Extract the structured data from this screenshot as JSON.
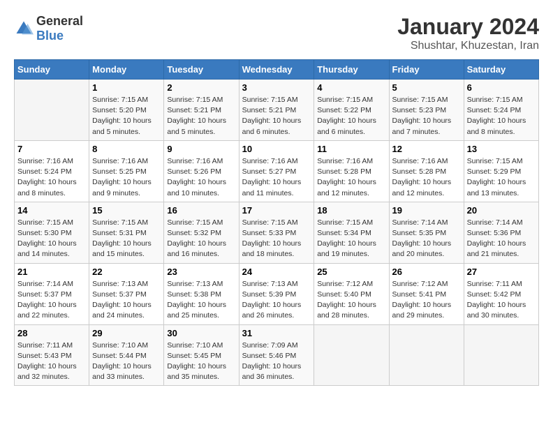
{
  "header": {
    "logo": {
      "general": "General",
      "blue": "Blue"
    },
    "title": "January 2024",
    "subtitle": "Shushtar, Khuzestan, Iran"
  },
  "days_of_week": [
    "Sunday",
    "Monday",
    "Tuesday",
    "Wednesday",
    "Thursday",
    "Friday",
    "Saturday"
  ],
  "weeks": [
    [
      {
        "day": null,
        "sunrise": null,
        "sunset": null,
        "daylight": null
      },
      {
        "day": "1",
        "sunrise": "Sunrise: 7:15 AM",
        "sunset": "Sunset: 5:20 PM",
        "daylight": "Daylight: 10 hours and 5 minutes."
      },
      {
        "day": "2",
        "sunrise": "Sunrise: 7:15 AM",
        "sunset": "Sunset: 5:21 PM",
        "daylight": "Daylight: 10 hours and 5 minutes."
      },
      {
        "day": "3",
        "sunrise": "Sunrise: 7:15 AM",
        "sunset": "Sunset: 5:21 PM",
        "daylight": "Daylight: 10 hours and 6 minutes."
      },
      {
        "day": "4",
        "sunrise": "Sunrise: 7:15 AM",
        "sunset": "Sunset: 5:22 PM",
        "daylight": "Daylight: 10 hours and 6 minutes."
      },
      {
        "day": "5",
        "sunrise": "Sunrise: 7:15 AM",
        "sunset": "Sunset: 5:23 PM",
        "daylight": "Daylight: 10 hours and 7 minutes."
      },
      {
        "day": "6",
        "sunrise": "Sunrise: 7:15 AM",
        "sunset": "Sunset: 5:24 PM",
        "daylight": "Daylight: 10 hours and 8 minutes."
      }
    ],
    [
      {
        "day": "7",
        "sunrise": "Sunrise: 7:16 AM",
        "sunset": "Sunset: 5:24 PM",
        "daylight": "Daylight: 10 hours and 8 minutes."
      },
      {
        "day": "8",
        "sunrise": "Sunrise: 7:16 AM",
        "sunset": "Sunset: 5:25 PM",
        "daylight": "Daylight: 10 hours and 9 minutes."
      },
      {
        "day": "9",
        "sunrise": "Sunrise: 7:16 AM",
        "sunset": "Sunset: 5:26 PM",
        "daylight": "Daylight: 10 hours and 10 minutes."
      },
      {
        "day": "10",
        "sunrise": "Sunrise: 7:16 AM",
        "sunset": "Sunset: 5:27 PM",
        "daylight": "Daylight: 10 hours and 11 minutes."
      },
      {
        "day": "11",
        "sunrise": "Sunrise: 7:16 AM",
        "sunset": "Sunset: 5:28 PM",
        "daylight": "Daylight: 10 hours and 12 minutes."
      },
      {
        "day": "12",
        "sunrise": "Sunrise: 7:16 AM",
        "sunset": "Sunset: 5:28 PM",
        "daylight": "Daylight: 10 hours and 12 minutes."
      },
      {
        "day": "13",
        "sunrise": "Sunrise: 7:15 AM",
        "sunset": "Sunset: 5:29 PM",
        "daylight": "Daylight: 10 hours and 13 minutes."
      }
    ],
    [
      {
        "day": "14",
        "sunrise": "Sunrise: 7:15 AM",
        "sunset": "Sunset: 5:30 PM",
        "daylight": "Daylight: 10 hours and 14 minutes."
      },
      {
        "day": "15",
        "sunrise": "Sunrise: 7:15 AM",
        "sunset": "Sunset: 5:31 PM",
        "daylight": "Daylight: 10 hours and 15 minutes."
      },
      {
        "day": "16",
        "sunrise": "Sunrise: 7:15 AM",
        "sunset": "Sunset: 5:32 PM",
        "daylight": "Daylight: 10 hours and 16 minutes."
      },
      {
        "day": "17",
        "sunrise": "Sunrise: 7:15 AM",
        "sunset": "Sunset: 5:33 PM",
        "daylight": "Daylight: 10 hours and 18 minutes."
      },
      {
        "day": "18",
        "sunrise": "Sunrise: 7:15 AM",
        "sunset": "Sunset: 5:34 PM",
        "daylight": "Daylight: 10 hours and 19 minutes."
      },
      {
        "day": "19",
        "sunrise": "Sunrise: 7:14 AM",
        "sunset": "Sunset: 5:35 PM",
        "daylight": "Daylight: 10 hours and 20 minutes."
      },
      {
        "day": "20",
        "sunrise": "Sunrise: 7:14 AM",
        "sunset": "Sunset: 5:36 PM",
        "daylight": "Daylight: 10 hours and 21 minutes."
      }
    ],
    [
      {
        "day": "21",
        "sunrise": "Sunrise: 7:14 AM",
        "sunset": "Sunset: 5:37 PM",
        "daylight": "Daylight: 10 hours and 22 minutes."
      },
      {
        "day": "22",
        "sunrise": "Sunrise: 7:13 AM",
        "sunset": "Sunset: 5:37 PM",
        "daylight": "Daylight: 10 hours and 24 minutes."
      },
      {
        "day": "23",
        "sunrise": "Sunrise: 7:13 AM",
        "sunset": "Sunset: 5:38 PM",
        "daylight": "Daylight: 10 hours and 25 minutes."
      },
      {
        "day": "24",
        "sunrise": "Sunrise: 7:13 AM",
        "sunset": "Sunset: 5:39 PM",
        "daylight": "Daylight: 10 hours and 26 minutes."
      },
      {
        "day": "25",
        "sunrise": "Sunrise: 7:12 AM",
        "sunset": "Sunset: 5:40 PM",
        "daylight": "Daylight: 10 hours and 28 minutes."
      },
      {
        "day": "26",
        "sunrise": "Sunrise: 7:12 AM",
        "sunset": "Sunset: 5:41 PM",
        "daylight": "Daylight: 10 hours and 29 minutes."
      },
      {
        "day": "27",
        "sunrise": "Sunrise: 7:11 AM",
        "sunset": "Sunset: 5:42 PM",
        "daylight": "Daylight: 10 hours and 30 minutes."
      }
    ],
    [
      {
        "day": "28",
        "sunrise": "Sunrise: 7:11 AM",
        "sunset": "Sunset: 5:43 PM",
        "daylight": "Daylight: 10 hours and 32 minutes."
      },
      {
        "day": "29",
        "sunrise": "Sunrise: 7:10 AM",
        "sunset": "Sunset: 5:44 PM",
        "daylight": "Daylight: 10 hours and 33 minutes."
      },
      {
        "day": "30",
        "sunrise": "Sunrise: 7:10 AM",
        "sunset": "Sunset: 5:45 PM",
        "daylight": "Daylight: 10 hours and 35 minutes."
      },
      {
        "day": "31",
        "sunrise": "Sunrise: 7:09 AM",
        "sunset": "Sunset: 5:46 PM",
        "daylight": "Daylight: 10 hours and 36 minutes."
      },
      {
        "day": null,
        "sunrise": null,
        "sunset": null,
        "daylight": null
      },
      {
        "day": null,
        "sunrise": null,
        "sunset": null,
        "daylight": null
      },
      {
        "day": null,
        "sunrise": null,
        "sunset": null,
        "daylight": null
      }
    ]
  ]
}
